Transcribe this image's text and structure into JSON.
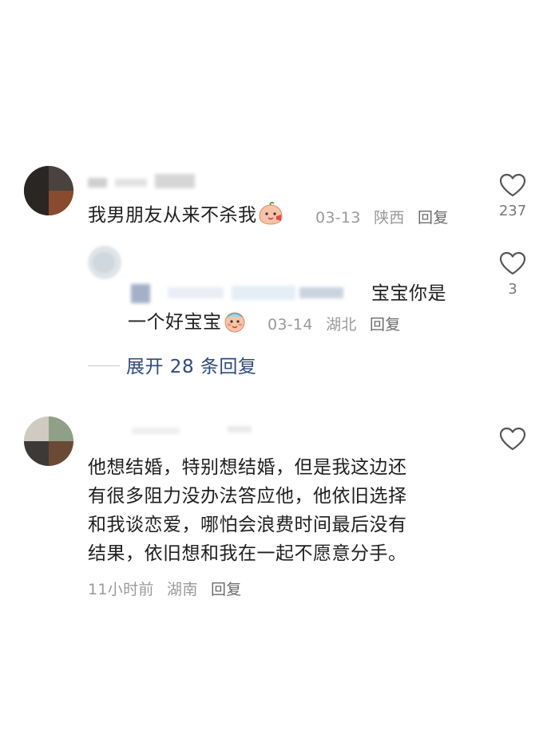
{
  "comments": [
    {
      "text": "我男朋友从来不杀我",
      "date": "03-13",
      "location": "陕西",
      "reply_label": "回复",
      "likes": "237",
      "replies": [
        {
          "text_line1": "宝宝你是",
          "text_line2": "一个好宝宝",
          "date": "03-14",
          "location": "湖北",
          "reply_label": "回复",
          "likes": "3"
        }
      ],
      "expand_label": "展开 28 条回复"
    },
    {
      "text_lines": [
        "他想结婚，特别想结婚，但是我这边还",
        "有很多阻力没办法答应他，他依旧选择",
        "和我谈恋爱，哪怕会浪费时间最后没有",
        "结果，依旧想和我在一起不愿意分手。"
      ],
      "time": "11小时前",
      "location": "湖南",
      "reply_label": "回复",
      "likes": ""
    }
  ],
  "icons": {
    "like": "heart-outline-icon",
    "emoji_1": "peach-face-emoji",
    "emoji_2": "peach-face-emoji"
  },
  "colors": {
    "text": "#1f1f1f",
    "meta": "#9a9a9a",
    "link": "#2e4a7d",
    "icon": "#555555"
  }
}
